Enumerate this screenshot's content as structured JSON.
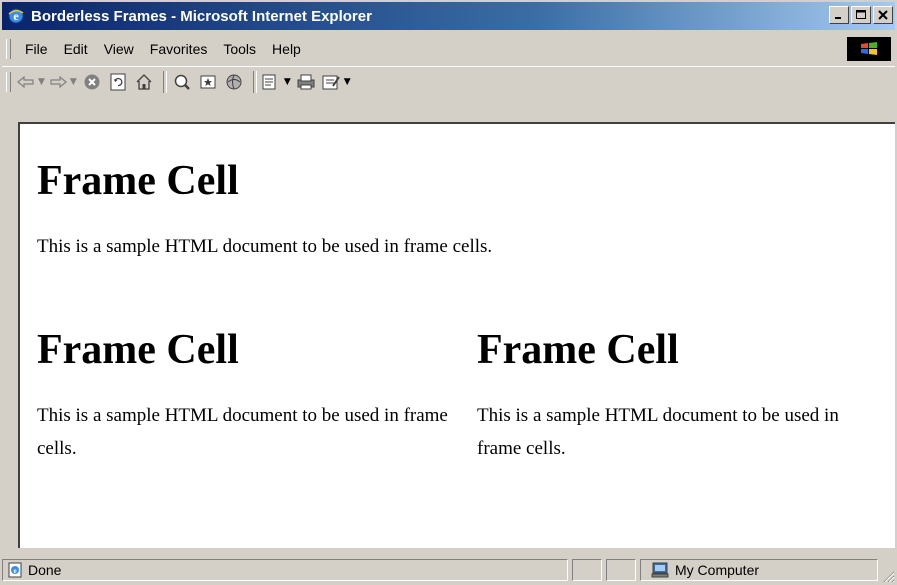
{
  "window": {
    "title": "Borderless Frames - Microsoft Internet Explorer",
    "buttons": {
      "minimize": "_",
      "maximize": "□",
      "close": "×"
    }
  },
  "menu": {
    "items": [
      {
        "label": "File"
      },
      {
        "label": "Edit"
      },
      {
        "label": "View"
      },
      {
        "label": "Favorites"
      },
      {
        "label": "Tools"
      },
      {
        "label": "Help"
      }
    ]
  },
  "toolbar": {
    "icons": [
      "back-icon",
      "forward-icon",
      "stop-icon",
      "refresh-icon",
      "home-icon",
      "search-icon",
      "favorites-icon",
      "history-icon",
      "mail-icon",
      "print-icon",
      "edit-icon"
    ]
  },
  "frames": {
    "top": {
      "heading": "Frame Cell",
      "text": "This is a sample HTML document to be used in frame cells."
    },
    "left": {
      "heading": "Frame Cell",
      "text": "This is a sample HTML document to be used in frame cells."
    },
    "right": {
      "heading": "Frame Cell",
      "text": "This is a sample HTML document to be used in frame cells."
    }
  },
  "status": {
    "text": "Done",
    "zone": "My Computer"
  },
  "colors": {
    "title_gradient_start": "#0a246a",
    "title_gradient_end": "#a6caf0",
    "chrome": "#d4d0c8",
    "content_bg": "#ffffff"
  }
}
